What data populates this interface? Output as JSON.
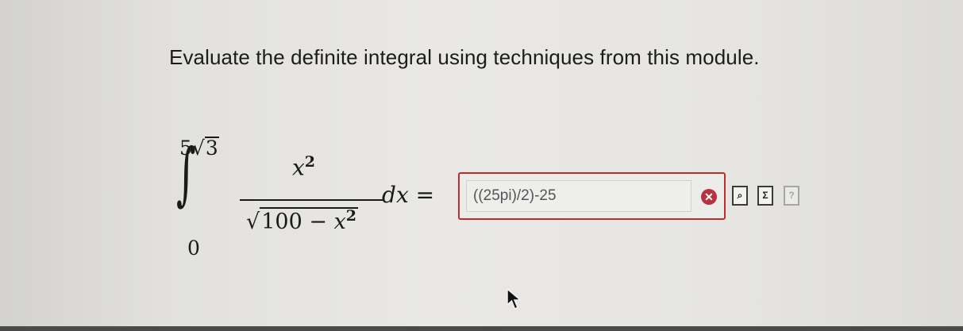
{
  "question": {
    "prompt": "Evaluate the definite integral using techniques from this module."
  },
  "integral": {
    "upper_limit_coefficient": "5",
    "upper_limit_radical_symbol": "√",
    "upper_limit_radicand": "3",
    "lower_limit": "0",
    "numerator_variable": "x",
    "numerator_exponent": "2",
    "denominator_radical_symbol": "√",
    "denominator_constant": "100 −",
    "denominator_variable": "x",
    "denominator_exponent": "2",
    "differential_d": "d",
    "differential_variable": "x",
    "equals": "="
  },
  "answer": {
    "value": "((25pi)/2)-25",
    "status": "incorrect"
  },
  "icons": {
    "status": "incorrect-x-icon",
    "tools": [
      "preview-icon",
      "equation-editor-icon",
      "help-icon"
    ]
  },
  "colors": {
    "error_border": "#c42a2a",
    "error_icon": "#b83340"
  }
}
